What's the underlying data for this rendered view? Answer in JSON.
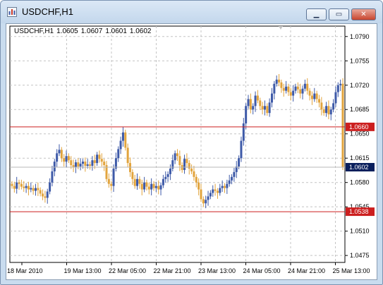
{
  "window": {
    "title": "USDCHF,H1",
    "buttons": {
      "minimize_icon": "minimize-icon",
      "maximize_icon": "maximize-icon",
      "close_icon": "close-icon"
    }
  },
  "chart_data": {
    "type": "candlestick",
    "symbol_label": "USDCHF,H1",
    "ohlc_values": [
      "1.0605",
      "1.0607",
      "1.0601",
      "1.0602"
    ],
    "ylim": [
      1.0465,
      1.0805
    ],
    "y_ticks": [
      "1.0790",
      "1.0755",
      "1.0720",
      "1.0685",
      "1.0650",
      "1.0615",
      "1.0580",
      "1.0545",
      "1.0510",
      "1.0475"
    ],
    "x_ticks": [
      "18 Mar 2010",
      "19 Mar 13:00",
      "22 Mar 05:00",
      "22 Mar 21:00",
      "23 Mar 13:00",
      "24 Mar 05:00",
      "24 Mar 21:00",
      "25 Mar 13:00"
    ],
    "grid": true,
    "bull_color": "#3e5aa8",
    "bear_color": "#e2a43d",
    "close_series": [
      1.0575,
      1.0571,
      1.058,
      1.0578,
      1.0574,
      1.0572,
      1.0575,
      1.057,
      1.0572,
      1.0568,
      1.0572,
      1.0569,
      1.0564,
      1.056,
      1.0558,
      1.0567,
      1.058,
      1.0596,
      1.061,
      1.0622,
      1.0627,
      1.0615,
      1.061,
      1.0618,
      1.0612,
      1.0605,
      1.0602,
      1.0609,
      1.0603,
      1.0607,
      1.061,
      1.0604,
      1.0606,
      1.0604,
      1.0612,
      1.0608,
      1.062,
      1.0614,
      1.061,
      1.0605,
      1.0585,
      1.0578,
      1.0575,
      1.06,
      1.0615,
      1.0628,
      1.064,
      1.0652,
      1.063,
      1.0608,
      1.0595,
      1.0585,
      1.0575,
      1.0585,
      1.0578,
      1.057,
      1.058,
      1.0574,
      1.057,
      1.0578,
      1.0572,
      1.0575,
      1.057,
      1.0576,
      1.0585,
      1.0588,
      1.0592,
      1.06,
      1.0612,
      1.0622,
      1.0618,
      1.0605,
      1.0598,
      1.0614,
      1.0608,
      1.06,
      1.0596,
      1.0588,
      1.058,
      1.057,
      1.0556,
      1.055,
      1.0555,
      1.056,
      1.0565,
      1.057,
      1.0568,
      1.0565,
      1.0572,
      1.0575,
      1.0572,
      1.0578,
      1.0583,
      1.0588,
      1.0595,
      1.0603,
      1.0615,
      1.064,
      1.0665,
      1.069,
      1.07,
      1.0685,
      1.069,
      1.0705,
      1.0698,
      1.069,
      1.0685,
      1.069,
      1.068,
      1.0695,
      1.0708,
      1.0722,
      1.0728,
      1.0724,
      1.0716,
      1.0712,
      1.0718,
      1.071,
      1.0705,
      1.0712,
      1.0718,
      1.0714,
      1.0708,
      1.0715,
      1.0722,
      1.0712,
      1.0705,
      1.07,
      1.0708,
      1.07,
      1.0695,
      1.0685,
      1.068,
      1.069,
      1.0678,
      1.0685,
      1.0694,
      1.071,
      1.072,
      1.0722,
      1.0602
    ],
    "horizontal_lines": [
      {
        "value": 1.066,
        "label": "1.0660",
        "color": "#cc1f1f",
        "label_bg": "#cc1f1f"
      },
      {
        "value": 1.0538,
        "label": "1.0538",
        "color": "#cc1f1f",
        "label_bg": "#cc1f1f"
      },
      {
        "value": 1.0602,
        "label": "1.0602",
        "color": "#b8b8b8",
        "label_bg": "#0a1f5c"
      }
    ]
  }
}
